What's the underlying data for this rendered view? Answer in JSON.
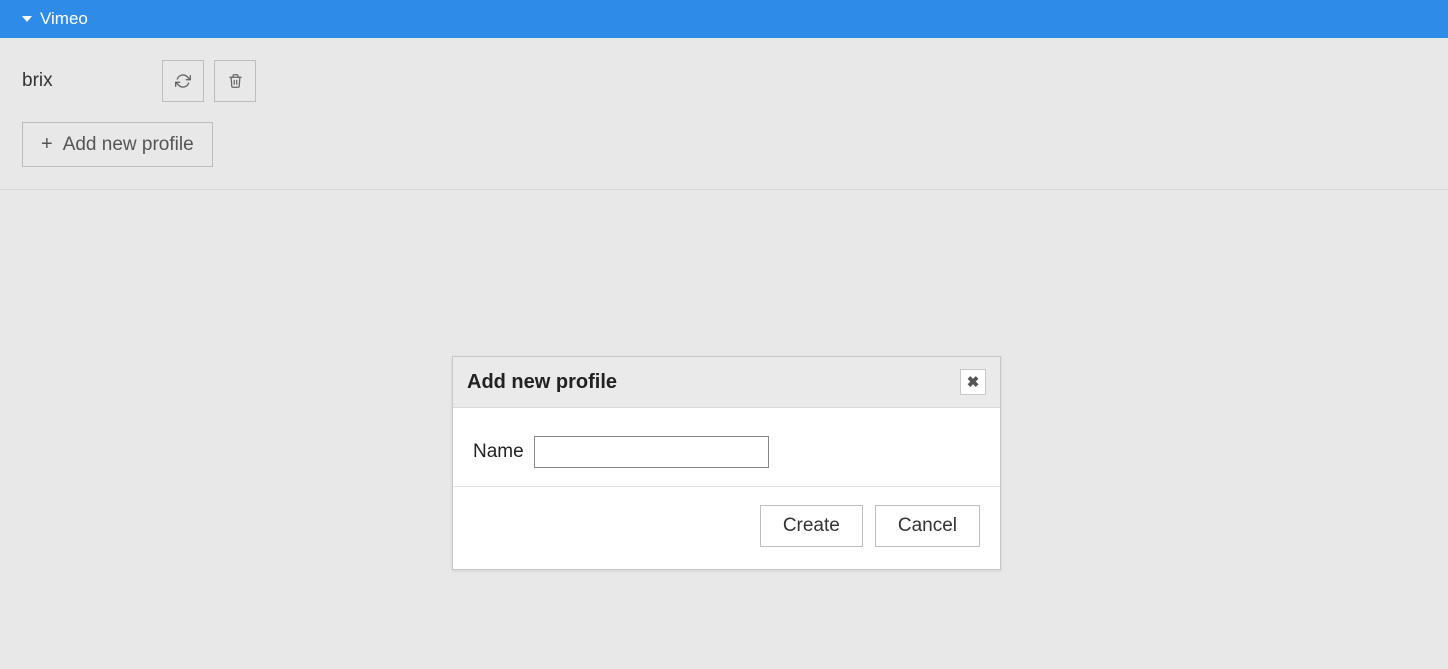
{
  "header": {
    "title": "Vimeo"
  },
  "profile": {
    "name": "brix"
  },
  "actions": {
    "add_profile_label": "Add new profile"
  },
  "dialog": {
    "title": "Add new profile",
    "name_label": "Name",
    "name_value": "",
    "create_label": "Create",
    "cancel_label": "Cancel"
  }
}
